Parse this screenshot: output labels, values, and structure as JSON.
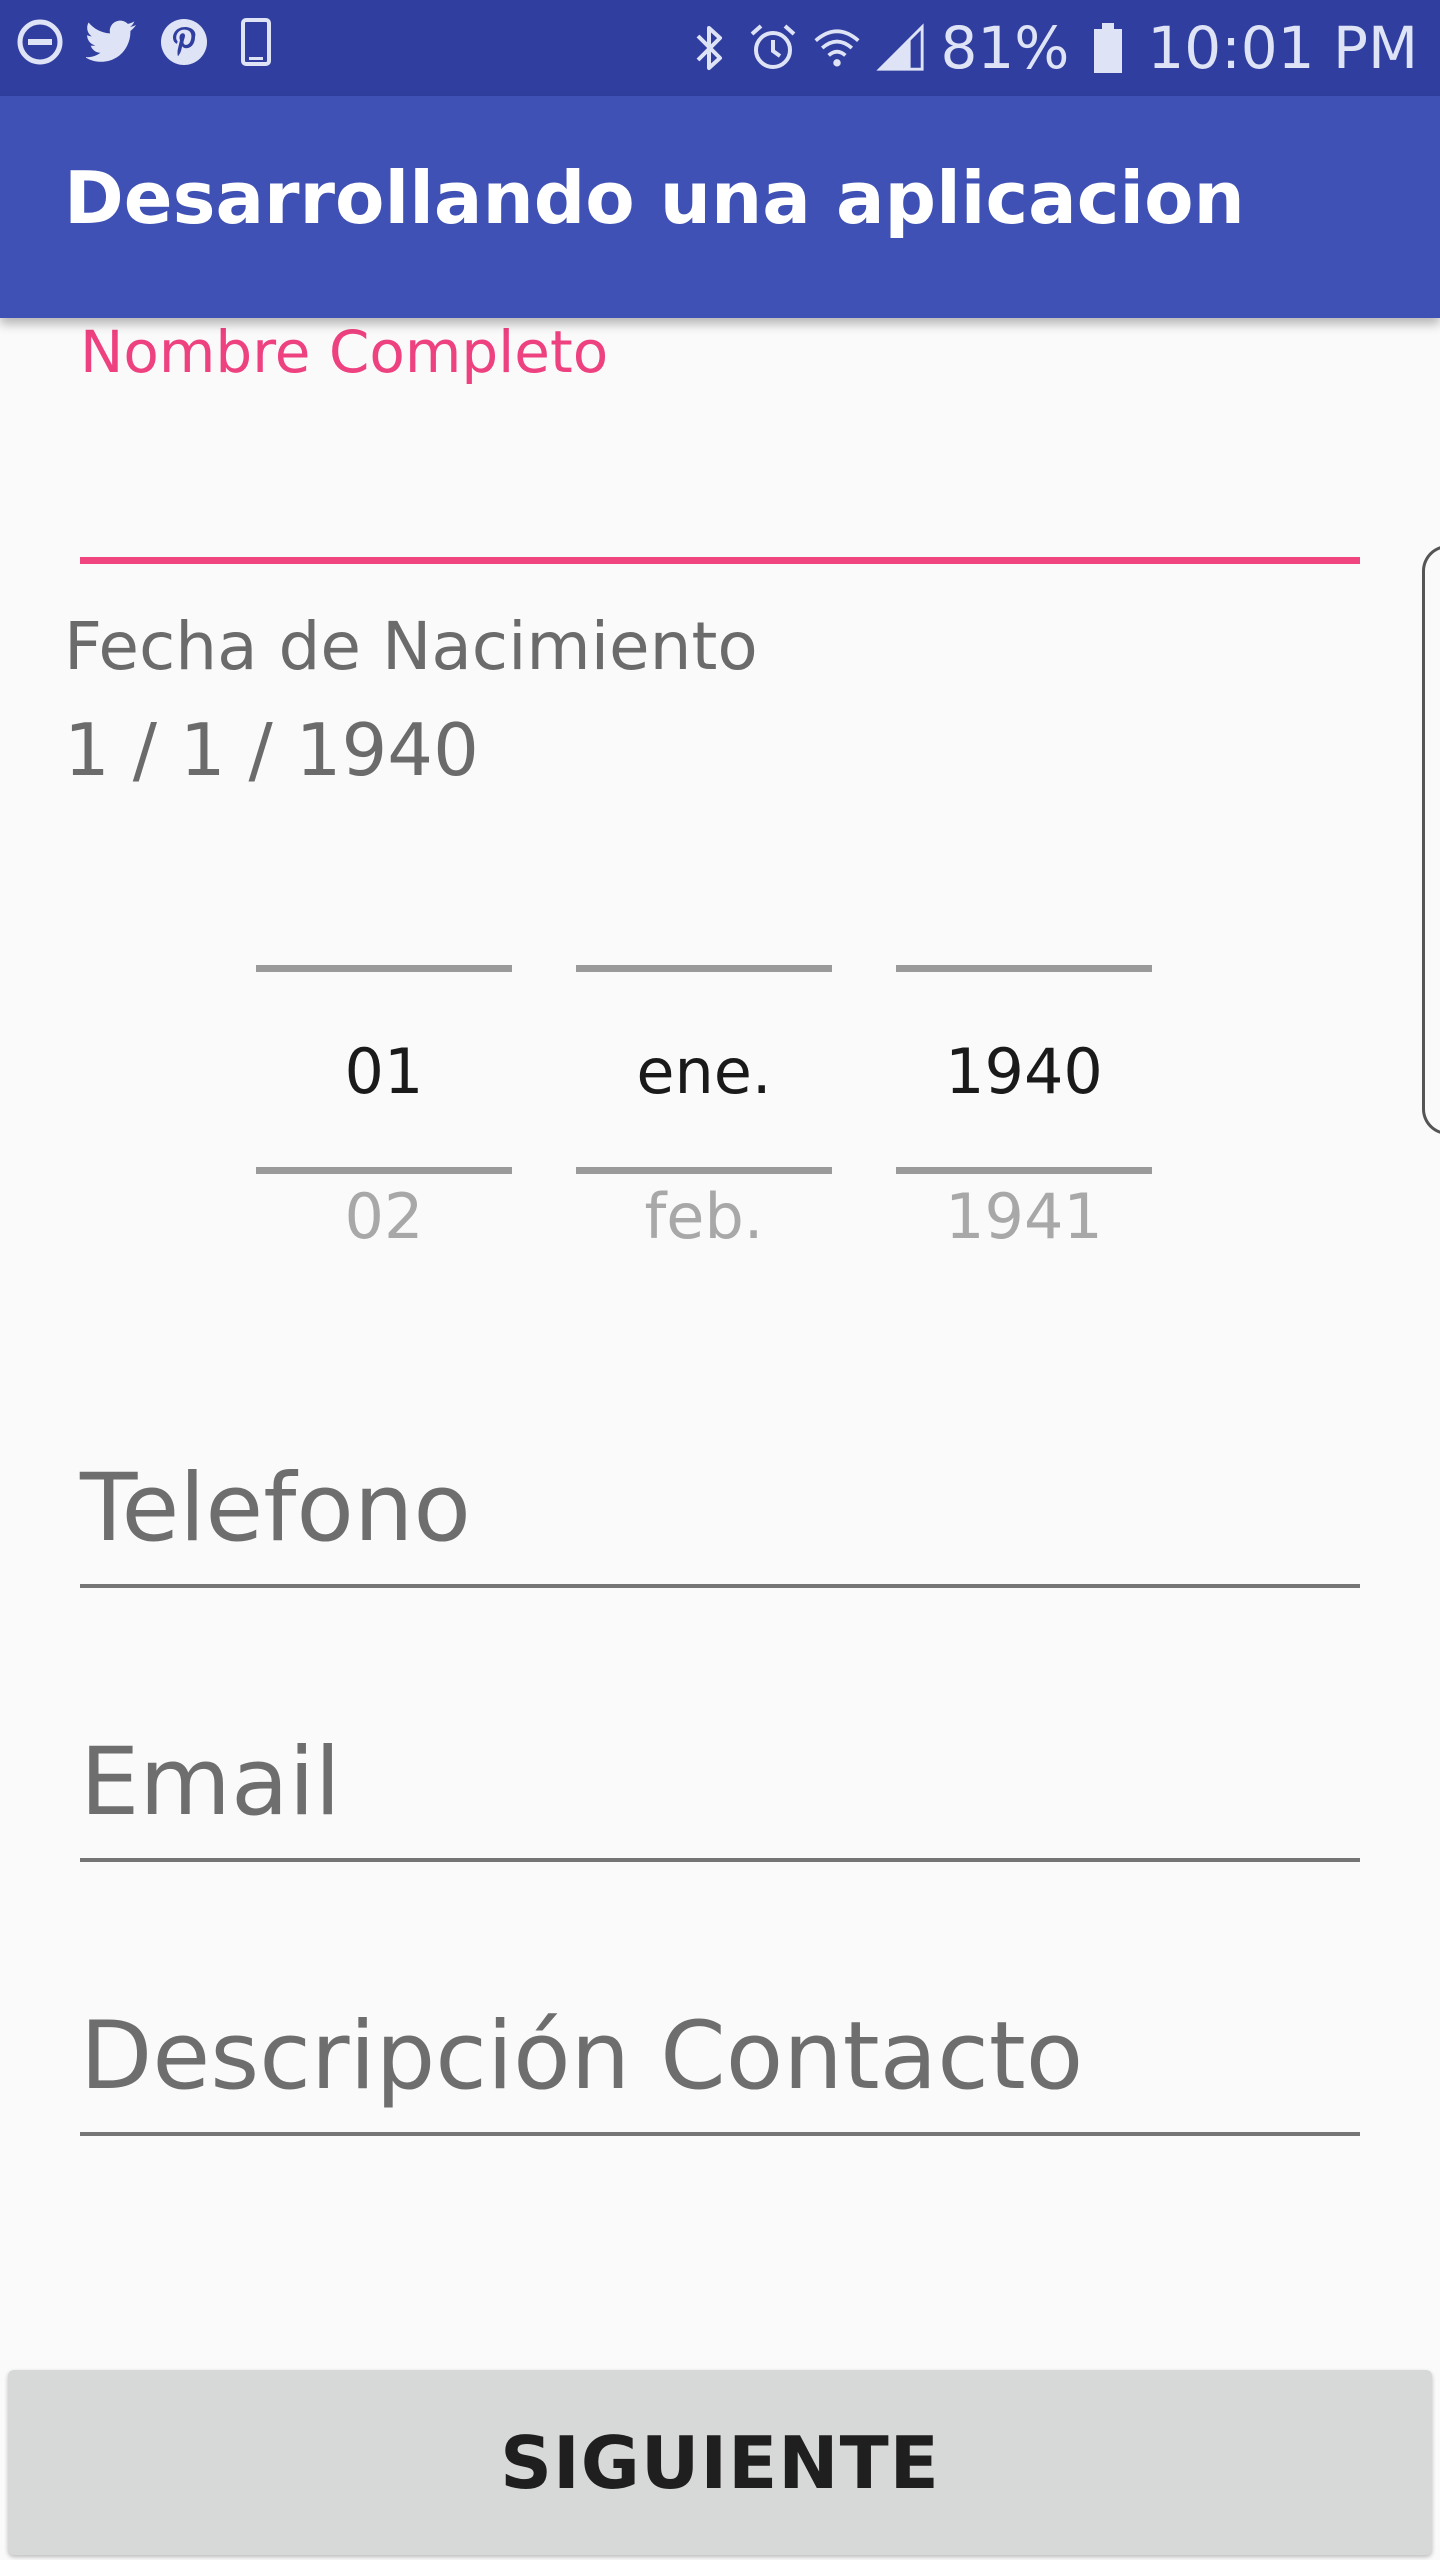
{
  "status_bar": {
    "left_icons": [
      "do-not-disturb-icon",
      "twitter-icon",
      "pinterest-icon",
      "phone-outline-icon"
    ],
    "right_icons": [
      "bluetooth-icon",
      "alarm-icon",
      "wifi-icon",
      "signal-icon"
    ],
    "battery_percent": "81%",
    "battery_level": 0.81,
    "time": "10:01 PM"
  },
  "app_bar": {
    "title": "Desarrollando una aplicacion"
  },
  "form": {
    "nombre": {
      "floating_label": "Nombre Completo",
      "value": ""
    },
    "fecha": {
      "label": "Fecha de Nacimiento",
      "value": "1 / 1 / 1940"
    },
    "date_picker": {
      "day": {
        "selected": "01",
        "next": "02"
      },
      "month": {
        "selected": "ene.",
        "next": "feb."
      },
      "year": {
        "selected": "1940",
        "next": "1941"
      }
    },
    "telefono": {
      "placeholder": "Telefono"
    },
    "email": {
      "placeholder": "Email"
    },
    "descripcion": {
      "placeholder": "Descripción Contacto"
    }
  },
  "actions": {
    "next_label": "SIGUIENTE"
  },
  "colors": {
    "status_bar": "#303f9f",
    "app_bar": "#3f51b5",
    "accent": "#ff4081",
    "background": "#fafafa"
  }
}
